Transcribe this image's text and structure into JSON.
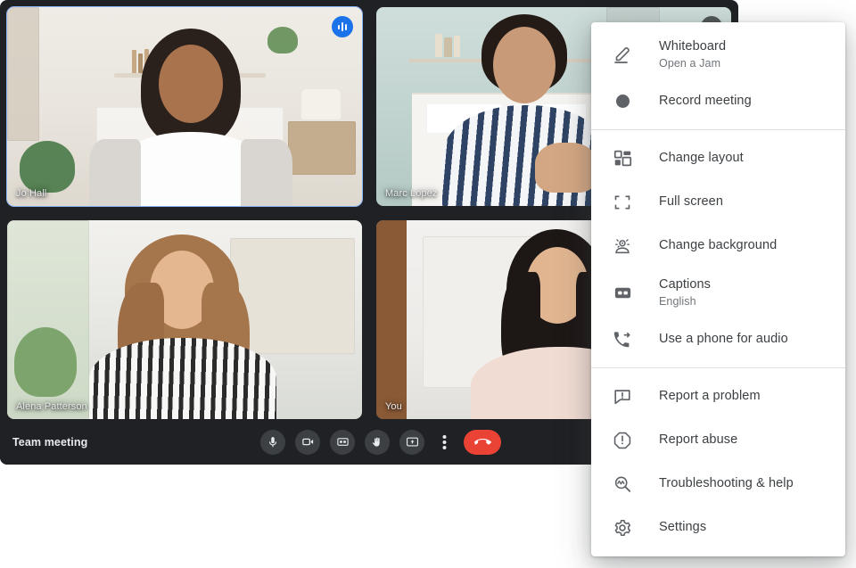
{
  "meeting": {
    "title": "Team meeting",
    "participants": [
      {
        "name": "Jo Hall",
        "indicator": "speaking",
        "active": true
      },
      {
        "name": "Marc Lopez",
        "indicator": "muted",
        "active": false
      },
      {
        "name": "Alena Patterson",
        "indicator": "none",
        "active": false
      },
      {
        "name": "You",
        "indicator": "none",
        "active": false
      }
    ],
    "controls": [
      {
        "name": "microphone-button",
        "icon": "mic-icon",
        "label": "Turn off microphone"
      },
      {
        "name": "camera-button",
        "icon": "camera-icon",
        "label": "Turn off camera"
      },
      {
        "name": "captions-button",
        "icon": "closed-caption-icon",
        "label": "Turn on captions"
      },
      {
        "name": "raise-hand-button",
        "icon": "hand-icon",
        "label": "Raise hand"
      },
      {
        "name": "present-screen-button",
        "icon": "present-screen-icon",
        "label": "Present now"
      },
      {
        "name": "more-options-button",
        "icon": "more-vertical-icon",
        "label": "More options"
      },
      {
        "name": "leave-call-button",
        "icon": "end-call-icon",
        "label": "Leave call"
      }
    ]
  },
  "menu": {
    "groups": [
      {
        "items": [
          {
            "icon": "whiteboard-pen-icon",
            "label": "Whiteboard",
            "sub": "Open a Jam"
          },
          {
            "icon": "record-circle-icon",
            "label": "Record meeting",
            "sub": ""
          }
        ]
      },
      {
        "items": [
          {
            "icon": "change-layout-icon",
            "label": "Change layout",
            "sub": ""
          },
          {
            "icon": "full-screen-icon",
            "label": "Full screen",
            "sub": ""
          },
          {
            "icon": "change-background-icon",
            "label": "Change background",
            "sub": ""
          },
          {
            "icon": "closed-caption-icon",
            "label": "Captions",
            "sub": "English"
          },
          {
            "icon": "phone-audio-icon",
            "label": "Use a phone for audio",
            "sub": ""
          }
        ]
      },
      {
        "items": [
          {
            "icon": "report-problem-icon",
            "label": "Report a problem",
            "sub": ""
          },
          {
            "icon": "report-abuse-icon",
            "label": "Report abuse",
            "sub": ""
          },
          {
            "icon": "troubleshooting-icon",
            "label": "Troubleshooting & help",
            "sub": ""
          },
          {
            "icon": "settings-gear-icon",
            "label": "Settings",
            "sub": ""
          }
        ]
      }
    ]
  },
  "colors": {
    "accent_blue": "#1a73e8",
    "active_border": "#8ab4f8",
    "hangup_red": "#ea4335",
    "window_bg": "#202124",
    "menu_bg": "#ffffff",
    "menu_text": "#3c4043",
    "menu_subtext": "#70757a"
  }
}
